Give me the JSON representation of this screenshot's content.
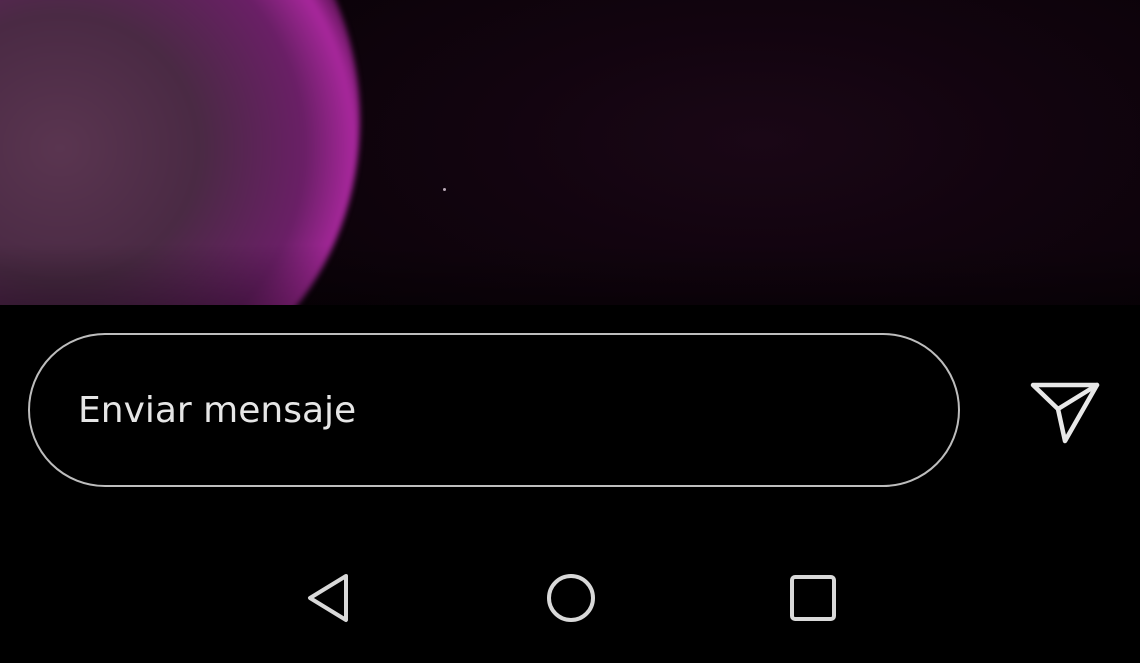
{
  "story": {
    "media_description_colors": {
      "background": "#0a0208",
      "accent": "#a8279c"
    }
  },
  "reply": {
    "placeholder": "Enviar mensaje",
    "value": "",
    "border_color": "#bdbdbd",
    "send_icon": "send-icon"
  },
  "nav": {
    "back_icon": "back-triangle-icon",
    "home_icon": "home-circle-icon",
    "recents_icon": "recents-square-icon",
    "icon_color": "#d9d9d9"
  }
}
